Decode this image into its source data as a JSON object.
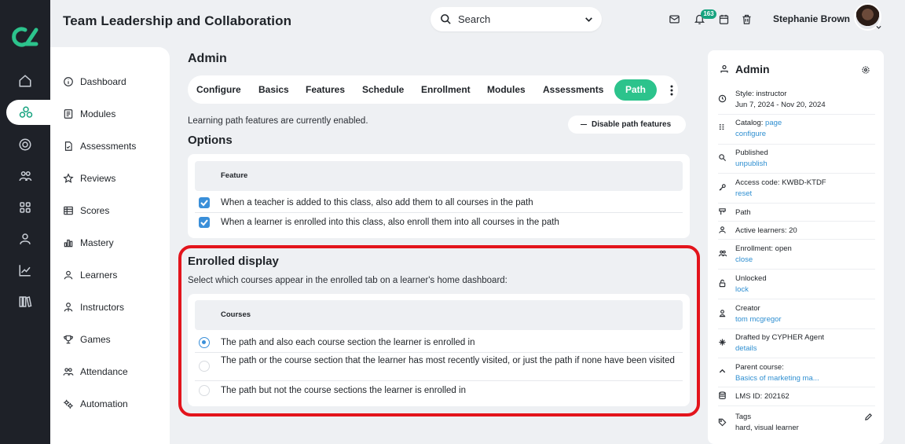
{
  "colors": {
    "accent": "#2cc38c",
    "brand": "#16a37f",
    "link": "#2f8fd1",
    "highlight": "#e3141c",
    "checkbox": "#3a8fd9"
  },
  "header": {
    "title": "Team Leadership and Collaboration",
    "search_placeholder": "Search",
    "notification_count": "163",
    "user_name": "Stephanie Brown"
  },
  "rail": {
    "items": [
      "home-icon",
      "classes-icon",
      "target-icon",
      "users-icon",
      "apps-icon",
      "person-icon",
      "chart-icon",
      "library-icon"
    ]
  },
  "sidebar": {
    "items": [
      {
        "label": "Dashboard",
        "icon": "info-icon"
      },
      {
        "label": "Modules",
        "icon": "modules-icon"
      },
      {
        "label": "Assessments",
        "icon": "assessment-icon"
      },
      {
        "label": "Reviews",
        "icon": "star-icon"
      },
      {
        "label": "Scores",
        "icon": "table-icon"
      },
      {
        "label": "Mastery",
        "icon": "bar-chart-icon"
      },
      {
        "label": "Learners",
        "icon": "person-icon"
      },
      {
        "label": "Instructors",
        "icon": "instructor-icon"
      },
      {
        "label": "Games",
        "icon": "trophy-icon"
      },
      {
        "label": "Attendance",
        "icon": "people-icon"
      },
      {
        "label": "Automation",
        "icon": "gears-icon"
      }
    ]
  },
  "main": {
    "heading": "Admin",
    "tabs": [
      "Configure",
      "Basics",
      "Features",
      "Schedule",
      "Enrollment",
      "Modules",
      "Assessments",
      "Path"
    ],
    "active_tab": "Path",
    "info_text": "Learning path features are currently enabled.",
    "disable_button": "Disable path features",
    "options": {
      "title": "Options",
      "header": "Feature",
      "rows": [
        {
          "label": "When a teacher is added to this class, also add them to all courses in the path",
          "checked": true
        },
        {
          "label": "When a learner is enrolled into this class, also enroll them into all courses in the path",
          "checked": true
        }
      ]
    },
    "enrolled": {
      "title": "Enrolled display",
      "description": "Select which courses appear in the enrolled tab on a learner's home dashboard:",
      "header": "Courses",
      "options": [
        {
          "label": "The path and also each course section the learner is enrolled in",
          "selected": true
        },
        {
          "label": "The path or the course section that the learner has most recently visited, or just the path if none have been visited",
          "selected": false
        },
        {
          "label": "The path but not the course sections the learner is enrolled in",
          "selected": false
        }
      ]
    }
  },
  "panel": {
    "title": "Admin",
    "items": [
      {
        "icon": "clock-icon",
        "line1": "Style: instructor",
        "line2": "Jun 7, 2024 - Nov 20, 2024",
        "link": ""
      },
      {
        "icon": "grid-icon",
        "line1": "Catalog:",
        "inline_link": "page",
        "link": "configure"
      },
      {
        "icon": "search-icon",
        "line1": "Published",
        "link": "unpublish"
      },
      {
        "icon": "key-icon",
        "line1": "Access code: KWBD-KTDF",
        "link": "reset"
      },
      {
        "icon": "path-icon",
        "line1": "Path",
        "link": ""
      },
      {
        "icon": "person-icon",
        "line1": "Active learners: 20",
        "link": ""
      },
      {
        "icon": "people-icon",
        "line1": "Enrollment: open",
        "link": "close"
      },
      {
        "icon": "lock-icon",
        "line1": "Unlocked",
        "link": "lock"
      },
      {
        "icon": "creator-icon",
        "line1": "Creator",
        "link": "tom mcgregor"
      },
      {
        "icon": "sparkle-icon",
        "line1": "Drafted by CYPHER Agent",
        "link": "details"
      },
      {
        "icon": "chevron-up-icon",
        "line1": "Parent course:",
        "link": "Basics of marketing ma..."
      },
      {
        "icon": "database-icon",
        "line1": "LMS ID: 202162",
        "link": ""
      },
      {
        "icon": "tag-icon",
        "line1": "Tags",
        "line2": "hard, visual learner",
        "link": ""
      }
    ]
  }
}
